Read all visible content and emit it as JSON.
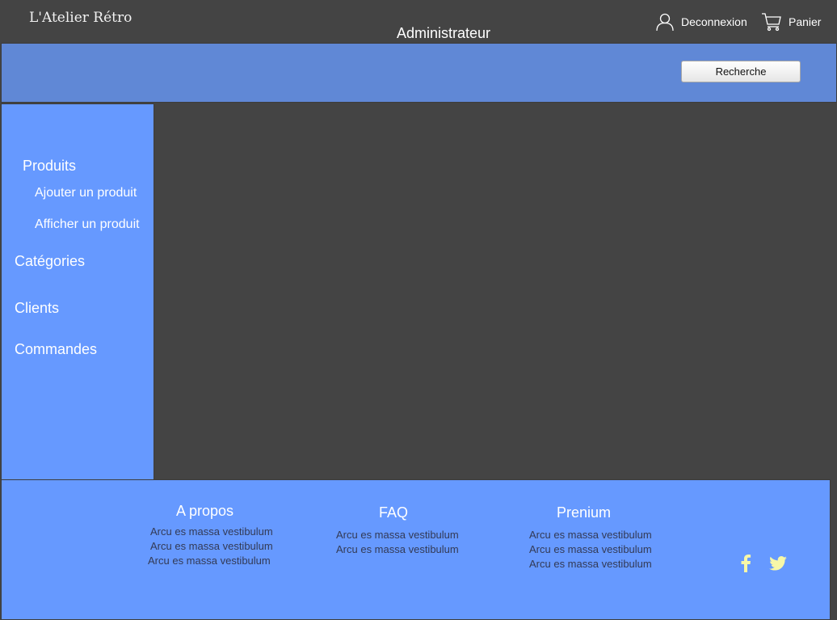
{
  "header": {
    "logo": "L'Atelier Rétro",
    "page_title": "Administrateur",
    "logout_label": "Deconnexion",
    "cart_label": "Panier"
  },
  "search": {
    "button_label": "Recherche"
  },
  "sidebar": {
    "produits": "Produits",
    "ajouter_produit": "Ajouter un produit",
    "afficher_produit": "Afficher un produit",
    "categories": "Catégories",
    "clients": "Clients",
    "commandes": "Commandes"
  },
  "footer": {
    "apropos": {
      "title": "A propos",
      "lines": [
        "Arcu es massa vestibulum",
        "Arcu es massa vestibulum",
        "Arcu es massa vestibulum"
      ]
    },
    "faq": {
      "title": "FAQ",
      "lines": [
        "Arcu es massa vestibulum",
        "Arcu es massa vestibulum"
      ]
    },
    "premium": {
      "title": "Prenium",
      "lines": [
        "Arcu es massa vestibulum",
        "Arcu es massa vestibulum",
        "Arcu es massa vestibulum"
      ]
    },
    "social": [
      "facebook-icon",
      "twitter-icon"
    ]
  },
  "colors": {
    "background": "#444444",
    "search_band": "#6088d6",
    "panel_blue": "#6699ff",
    "social_icon": "#f7f7a8"
  }
}
